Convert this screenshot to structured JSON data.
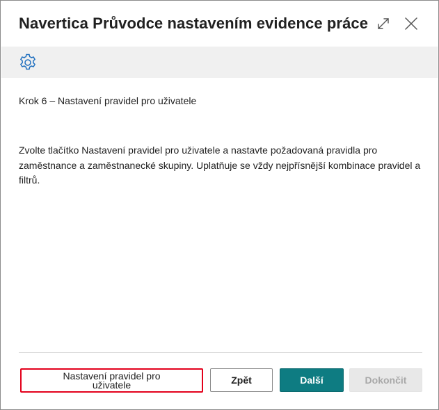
{
  "dialog": {
    "title": "Navertica Průvodce nastavením evidence práce ...",
    "expand_icon": "expand-icon",
    "close_icon": "close-icon"
  },
  "toolbar": {
    "settings_icon": "gear-icon"
  },
  "content": {
    "step_text": "Krok 6 – Nastavení pravidel pro uživatele",
    "description": "Zvolte tlačítko Nastavení pravidel pro uživatele a nastavte požadovaná pravidla pro zaměstnance a zaměstnanecké skupiny. Uplatňuje se vždy nejpřísnější kombinace pravidel a filtrů."
  },
  "actions": {
    "rules_label": "Nastavení pravidel pro uživatele",
    "back_label": "Zpět",
    "next_label": "Další",
    "finish_label": "Dokončit"
  },
  "colors": {
    "accent": "#0e7c82",
    "highlight_border": "#e3001b",
    "gear": "#1f6fbf"
  }
}
